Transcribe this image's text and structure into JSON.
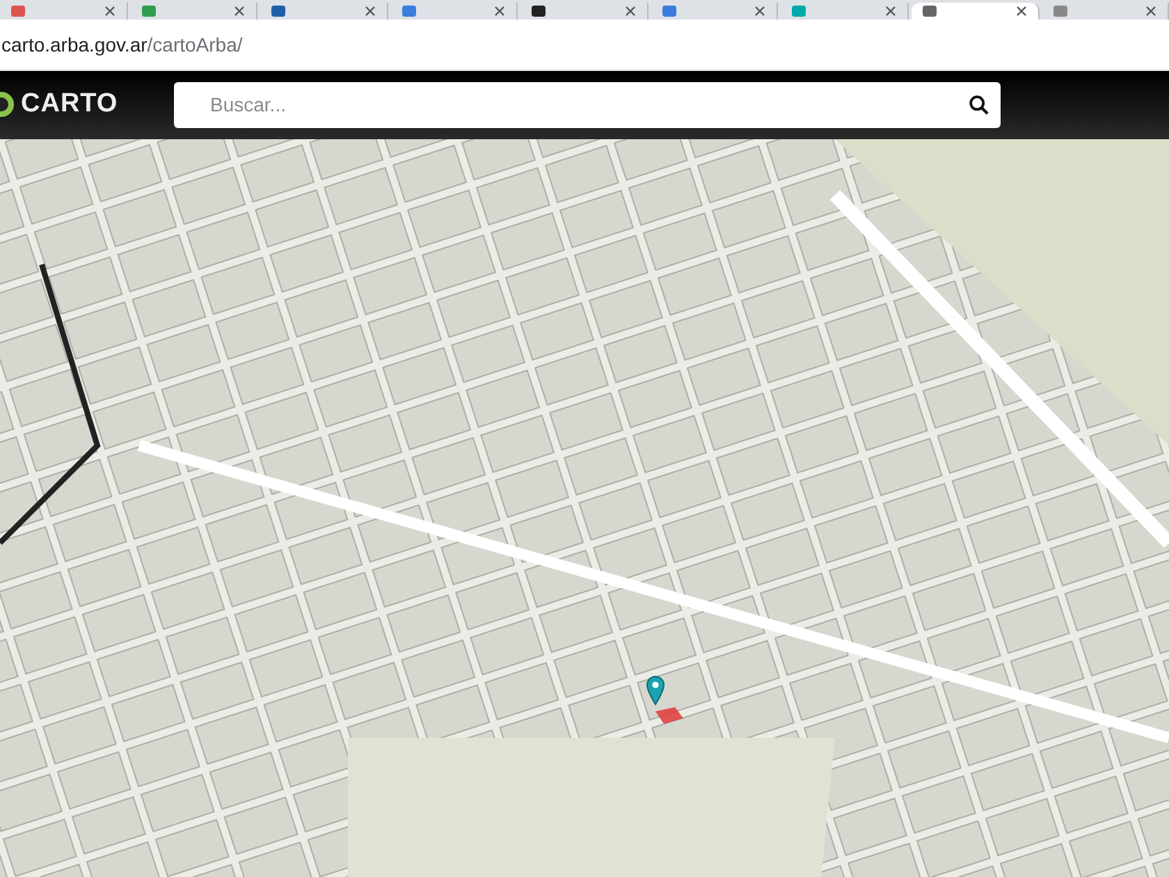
{
  "browser": {
    "tabs": [
      {
        "selected": false
      },
      {
        "selected": false
      },
      {
        "selected": false
      },
      {
        "selected": false
      },
      {
        "selected": false
      },
      {
        "selected": false
      },
      {
        "selected": false
      },
      {
        "selected": true
      },
      {
        "selected": false
      }
    ],
    "url": {
      "host": "carto.arba.gov.ar",
      "path": "/cartoArba/"
    }
  },
  "header": {
    "logo": "CARTO",
    "search": {
      "placeholder": "Buscar..."
    }
  }
}
